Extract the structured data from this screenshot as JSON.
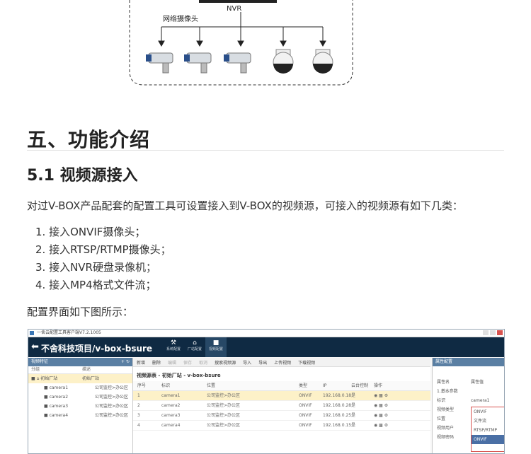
{
  "diagram": {
    "nvr_label": "NVR",
    "camera_group_label": "网络摄像头"
  },
  "section": {
    "h1": "五、功能介绍",
    "h2": "5.1 视频源接入"
  },
  "intro": "对过V-BOX产品配套的配置工具可设置接入到V-BOX的视频源，可接入的视频源有如下几类：",
  "list": [
    "1. 接入ONVIF摄像头；",
    "2. 接入RTSP/RTMP摄像头；",
    "3. 接入NVR硬盘录像机；",
    "4. 接入MP4格式文件流；"
  ],
  "caption": "配置界面如下图所示：",
  "screenshot": {
    "window_title": "一舍云配置工具客户端V7.2.1005",
    "app_title": "不舍科技项目/v-box-bsure",
    "nav": [
      {
        "label": "系统配置",
        "icon": "wrench-icon"
      },
      {
        "label": "厂站配置",
        "icon": "home-icon"
      },
      {
        "label": "视频配置",
        "icon": "video-icon"
      }
    ],
    "left_panel": {
      "title": "视频特征",
      "col1": "分组",
      "col2": "描述",
      "group": {
        "name": "初始厂站",
        "desc": "初始厂站"
      },
      "cameras": [
        {
          "name": "camera1",
          "desc": "公司监控>办公区"
        },
        {
          "name": "camera2",
          "desc": "公司监控>办公区"
        },
        {
          "name": "camera3",
          "desc": "公司监控>办公区"
        },
        {
          "name": "camera4",
          "desc": "公司监控>办公区"
        }
      ]
    },
    "toolbar": [
      "新增",
      "删除",
      "编辑",
      "保存",
      "取消",
      "搜索视频源",
      "导入",
      "导出",
      "上传视频",
      "下载视频"
    ],
    "breadcrumb": "视频源表 - 初始厂站 - v-box-bsure",
    "table": {
      "headers": [
        "序号",
        "标识",
        "位置",
        "类型",
        "IP",
        "云台控制",
        "操作"
      ],
      "rows": [
        [
          "1",
          "camera1",
          "公司监控>办公区",
          "ONVIF",
          "192.168.0.18",
          "是"
        ],
        [
          "2",
          "camera2",
          "公司监控>办公区",
          "ONVIF",
          "192.168.0.28",
          "是"
        ],
        [
          "3",
          "camera3",
          "公司监控>办公区",
          "ONVIF",
          "192.168.0.25",
          "是"
        ],
        [
          "4",
          "camera4",
          "公司监控>办公区",
          "ONVIF",
          "192.168.0.15",
          "是"
        ]
      ]
    },
    "right_panel": {
      "title": "属性配置",
      "col1": "属性名",
      "col2": "属性值",
      "section": "1.基本参数",
      "rows": [
        {
          "k": "标识",
          "v": "camera1"
        },
        {
          "k": "视频类型",
          "v": "ONVIF"
        },
        {
          "k": "位置",
          "v": ""
        },
        {
          "k": "视频用户",
          "v": ""
        },
        {
          "k": "视频密码",
          "v": ""
        }
      ],
      "dropdown": [
        "文件流",
        "RTSP/RTMP",
        "ONVIF"
      ]
    }
  }
}
